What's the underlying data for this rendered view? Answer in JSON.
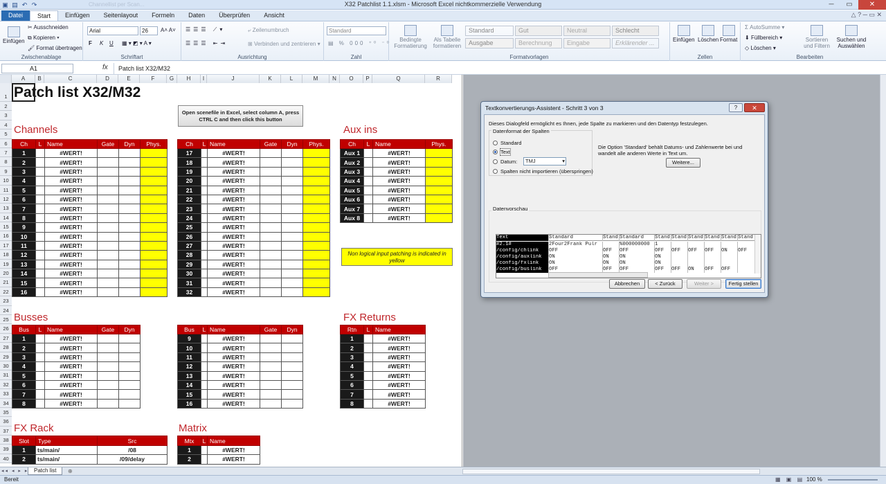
{
  "window": {
    "title": "X32 Patchlist 1.1.xlsm  -  Microsoft Excel nichtkommerzielle Verwendung",
    "ghost_text": "Channellist per Scan..."
  },
  "ribbon_tabs": [
    "Datei",
    "Start",
    "Einfügen",
    "Seitenlayout",
    "Formeln",
    "Daten",
    "Überprüfen",
    "Ansicht"
  ],
  "ribbon": {
    "clipboard": {
      "paste": "Einfügen",
      "cut": "Ausschneiden",
      "copy": "Kopieren",
      "format": "Format übertragen",
      "label": "Zwischenablage"
    },
    "font": {
      "name": "Arial",
      "size": "26",
      "label": "Schriftart",
      "bold": "F",
      "italic": "K",
      "underline": "U"
    },
    "alignment": {
      "wrap": "Zeilenumbruch",
      "merge": "Verbinden und zentrieren",
      "label": "Ausrichtung"
    },
    "number": {
      "format": "Standard",
      "label": "Zahl"
    },
    "styles": {
      "conditional": "Bedingte Formatierung",
      "table": "Als Tabelle formatieren",
      "label": "Formatvorlagen",
      "cells": [
        "Standard",
        "Gut",
        "Neutral",
        "Schlecht",
        "Ausgabe",
        "Berechnung",
        "Eingabe",
        "Erklärender ..."
      ]
    },
    "cells": {
      "insert": "Einfügen",
      "delete": "Löschen",
      "format": "Format",
      "label": "Zellen"
    },
    "editing": {
      "autosum": "AutoSumme",
      "fill": "Füllbereich",
      "clear": "Löschen",
      "sort": "Sortieren und Filtern",
      "find": "Suchen und Auswählen",
      "label": "Bearbeiten"
    }
  },
  "formula_bar": {
    "cell": "A1",
    "fx": "fx",
    "content": "Patch list X32/M32"
  },
  "columns": [
    [
      "A",
      34
    ],
    [
      "B",
      13
    ],
    [
      "C",
      76
    ],
    [
      "D",
      31
    ],
    [
      "E",
      31
    ],
    [
      "F",
      39
    ],
    [
      "G",
      15
    ],
    [
      "H",
      34
    ],
    [
      "I",
      9
    ],
    [
      "J",
      76
    ],
    [
      "K",
      31
    ],
    [
      "L",
      31
    ],
    [
      "M",
      39
    ],
    [
      "N",
      15
    ],
    [
      "O",
      34
    ],
    [
      "P",
      13
    ],
    [
      "Q",
      76
    ],
    [
      "R",
      39
    ]
  ],
  "rows": [
    "1",
    "2",
    "3",
    "4",
    "5",
    "6",
    "7",
    "8",
    "9",
    "10",
    "11",
    "12",
    "13",
    "14",
    "15",
    "16",
    "17",
    "18",
    "19",
    "20",
    "21",
    "22",
    "23",
    "24",
    "25",
    "26",
    "27",
    "28",
    "29",
    "30",
    "31",
    "32",
    "33",
    "34",
    "35",
    "36",
    "37",
    "38",
    "39",
    "40"
  ],
  "sheet": {
    "title": "Patch list X32/M32",
    "macro_button": "Open scenefile in Excel, select column A, press CTRL C and then click this button",
    "note": "Non logical input patching is indicated in yellow",
    "sections": {
      "channels": "Channels",
      "aux_ins": "Aux ins",
      "busses": "Busses",
      "fx_returns": "FX Returns",
      "fx_rack": "FX Rack",
      "matrix": "Matrix"
    },
    "headers": {
      "ch": "Ch",
      "l": "L",
      "name": "Name",
      "gate": "Gate",
      "dyn": "Dyn",
      "phys": "Phys.",
      "bus": "Bus",
      "rtn": "Rtn",
      "slot": "Slot",
      "type": "Type",
      "src": "Src",
      "mtx": "Mtx"
    },
    "err": "#WERT!",
    "ch_a": [
      "1",
      "2",
      "3",
      "4",
      "5",
      "6",
      "7",
      "8",
      "9",
      "10",
      "11",
      "12",
      "13",
      "14",
      "15",
      "16"
    ],
    "ch_b": [
      "17",
      "18",
      "19",
      "20",
      "21",
      "22",
      "23",
      "24",
      "25",
      "26",
      "27",
      "28",
      "29",
      "30",
      "31",
      "32"
    ],
    "aux": [
      "Aux 1",
      "Aux 2",
      "Aux 3",
      "Aux 4",
      "Aux 5",
      "Aux 6",
      "Aux 7",
      "Aux 8"
    ],
    "bus_a": [
      "1",
      "2",
      "3",
      "4",
      "5",
      "6",
      "7",
      "8"
    ],
    "bus_b": [
      "9",
      "10",
      "11",
      "12",
      "13",
      "14",
      "15",
      "16"
    ],
    "fx_ret": [
      "1",
      "2",
      "3",
      "4",
      "5",
      "6",
      "7",
      "8"
    ],
    "fx_rack": [
      {
        "slot": "1",
        "type": "ts/main/",
        "src": "/08"
      },
      {
        "slot": "2",
        "type": "ts/main/",
        "src": "/09/delay"
      }
    ],
    "matrix": [
      "1",
      "2"
    ]
  },
  "sheet_tab": "Patch list",
  "status": {
    "ready": "Bereit",
    "zoom": "100 %"
  },
  "dialog": {
    "title": "Textkonvertierungs-Assistent - Schritt 3 von 3",
    "help": "?",
    "intro": "Dieses Dialogfeld ermöglicht es Ihnen, jede Spalte zu markieren und den Datentyp festzulegen.",
    "group_label": "Datenformat der Spalten",
    "options": [
      "Standard",
      "Text",
      "Datum:",
      "Spalten nicht importieren (überspringen)"
    ],
    "date_format": "TMJ",
    "info": "Die Option 'Standard' behält Datums- und Zahlenwerte bei und wandelt alle anderen Werte in Text um.",
    "more": "Weitere...",
    "preview_label": "Datenvorschau",
    "preview_header": [
      "Text",
      "Standard",
      "Stand",
      "Standard",
      "Stand",
      "Stand",
      "Stand",
      "Stand",
      "Stand",
      "Stand"
    ],
    "preview_rows": [
      [
        "#2.1#",
        "2Four2Frank Pulr",
        "",
        "%000000000",
        "1",
        "",
        "",
        "",
        "",
        ""
      ],
      [
        "/config/chlink",
        "OFF",
        "OFF",
        "OFF",
        "OFF",
        "OFF",
        "OFF",
        "OFF",
        "ON",
        "OFF"
      ],
      [
        "/config/auxlink",
        "ON",
        "ON",
        "ON",
        "ON",
        "",
        "",
        "",
        "",
        ""
      ],
      [
        "/config/fxlink",
        "ON",
        "ON",
        "ON",
        "ON",
        "",
        "",
        "",
        "",
        ""
      ],
      [
        "/config/buslink",
        "OFF",
        "OFF",
        "OFF",
        "OFF",
        "OFF",
        "ON",
        "OFF",
        "OFF",
        ""
      ]
    ],
    "buttons": {
      "cancel": "Abbrechen",
      "back": "< Zurück",
      "next": "Weiter >",
      "finish": "Fertig stellen"
    }
  }
}
